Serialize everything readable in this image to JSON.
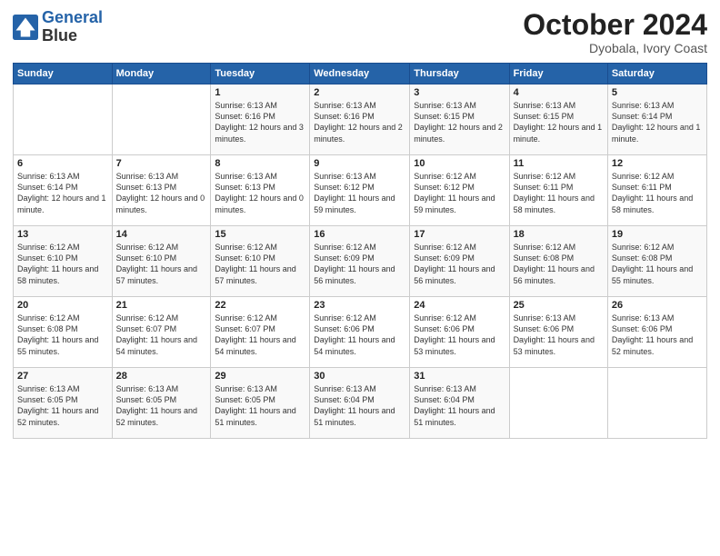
{
  "logo": {
    "line1": "General",
    "line2": "Blue"
  },
  "header": {
    "month": "October 2024",
    "location": "Dyobala, Ivory Coast"
  },
  "days_of_week": [
    "Sunday",
    "Monday",
    "Tuesday",
    "Wednesday",
    "Thursday",
    "Friday",
    "Saturday"
  ],
  "weeks": [
    [
      {
        "day": "",
        "info": ""
      },
      {
        "day": "",
        "info": ""
      },
      {
        "day": "1",
        "info": "Sunrise: 6:13 AM\nSunset: 6:16 PM\nDaylight: 12 hours and 3 minutes."
      },
      {
        "day": "2",
        "info": "Sunrise: 6:13 AM\nSunset: 6:16 PM\nDaylight: 12 hours and 2 minutes."
      },
      {
        "day": "3",
        "info": "Sunrise: 6:13 AM\nSunset: 6:15 PM\nDaylight: 12 hours and 2 minutes."
      },
      {
        "day": "4",
        "info": "Sunrise: 6:13 AM\nSunset: 6:15 PM\nDaylight: 12 hours and 1 minute."
      },
      {
        "day": "5",
        "info": "Sunrise: 6:13 AM\nSunset: 6:14 PM\nDaylight: 12 hours and 1 minute."
      }
    ],
    [
      {
        "day": "6",
        "info": "Sunrise: 6:13 AM\nSunset: 6:14 PM\nDaylight: 12 hours and 1 minute."
      },
      {
        "day": "7",
        "info": "Sunrise: 6:13 AM\nSunset: 6:13 PM\nDaylight: 12 hours and 0 minutes."
      },
      {
        "day": "8",
        "info": "Sunrise: 6:13 AM\nSunset: 6:13 PM\nDaylight: 12 hours and 0 minutes."
      },
      {
        "day": "9",
        "info": "Sunrise: 6:13 AM\nSunset: 6:12 PM\nDaylight: 11 hours and 59 minutes."
      },
      {
        "day": "10",
        "info": "Sunrise: 6:12 AM\nSunset: 6:12 PM\nDaylight: 11 hours and 59 minutes."
      },
      {
        "day": "11",
        "info": "Sunrise: 6:12 AM\nSunset: 6:11 PM\nDaylight: 11 hours and 58 minutes."
      },
      {
        "day": "12",
        "info": "Sunrise: 6:12 AM\nSunset: 6:11 PM\nDaylight: 11 hours and 58 minutes."
      }
    ],
    [
      {
        "day": "13",
        "info": "Sunrise: 6:12 AM\nSunset: 6:10 PM\nDaylight: 11 hours and 58 minutes."
      },
      {
        "day": "14",
        "info": "Sunrise: 6:12 AM\nSunset: 6:10 PM\nDaylight: 11 hours and 57 minutes."
      },
      {
        "day": "15",
        "info": "Sunrise: 6:12 AM\nSunset: 6:10 PM\nDaylight: 11 hours and 57 minutes."
      },
      {
        "day": "16",
        "info": "Sunrise: 6:12 AM\nSunset: 6:09 PM\nDaylight: 11 hours and 56 minutes."
      },
      {
        "day": "17",
        "info": "Sunrise: 6:12 AM\nSunset: 6:09 PM\nDaylight: 11 hours and 56 minutes."
      },
      {
        "day": "18",
        "info": "Sunrise: 6:12 AM\nSunset: 6:08 PM\nDaylight: 11 hours and 56 minutes."
      },
      {
        "day": "19",
        "info": "Sunrise: 6:12 AM\nSunset: 6:08 PM\nDaylight: 11 hours and 55 minutes."
      }
    ],
    [
      {
        "day": "20",
        "info": "Sunrise: 6:12 AM\nSunset: 6:08 PM\nDaylight: 11 hours and 55 minutes."
      },
      {
        "day": "21",
        "info": "Sunrise: 6:12 AM\nSunset: 6:07 PM\nDaylight: 11 hours and 54 minutes."
      },
      {
        "day": "22",
        "info": "Sunrise: 6:12 AM\nSunset: 6:07 PM\nDaylight: 11 hours and 54 minutes."
      },
      {
        "day": "23",
        "info": "Sunrise: 6:12 AM\nSunset: 6:06 PM\nDaylight: 11 hours and 54 minutes."
      },
      {
        "day": "24",
        "info": "Sunrise: 6:12 AM\nSunset: 6:06 PM\nDaylight: 11 hours and 53 minutes."
      },
      {
        "day": "25",
        "info": "Sunrise: 6:13 AM\nSunset: 6:06 PM\nDaylight: 11 hours and 53 minutes."
      },
      {
        "day": "26",
        "info": "Sunrise: 6:13 AM\nSunset: 6:06 PM\nDaylight: 11 hours and 52 minutes."
      }
    ],
    [
      {
        "day": "27",
        "info": "Sunrise: 6:13 AM\nSunset: 6:05 PM\nDaylight: 11 hours and 52 minutes."
      },
      {
        "day": "28",
        "info": "Sunrise: 6:13 AM\nSunset: 6:05 PM\nDaylight: 11 hours and 52 minutes."
      },
      {
        "day": "29",
        "info": "Sunrise: 6:13 AM\nSunset: 6:05 PM\nDaylight: 11 hours and 51 minutes."
      },
      {
        "day": "30",
        "info": "Sunrise: 6:13 AM\nSunset: 6:04 PM\nDaylight: 11 hours and 51 minutes."
      },
      {
        "day": "31",
        "info": "Sunrise: 6:13 AM\nSunset: 6:04 PM\nDaylight: 11 hours and 51 minutes."
      },
      {
        "day": "",
        "info": ""
      },
      {
        "day": "",
        "info": ""
      }
    ]
  ]
}
